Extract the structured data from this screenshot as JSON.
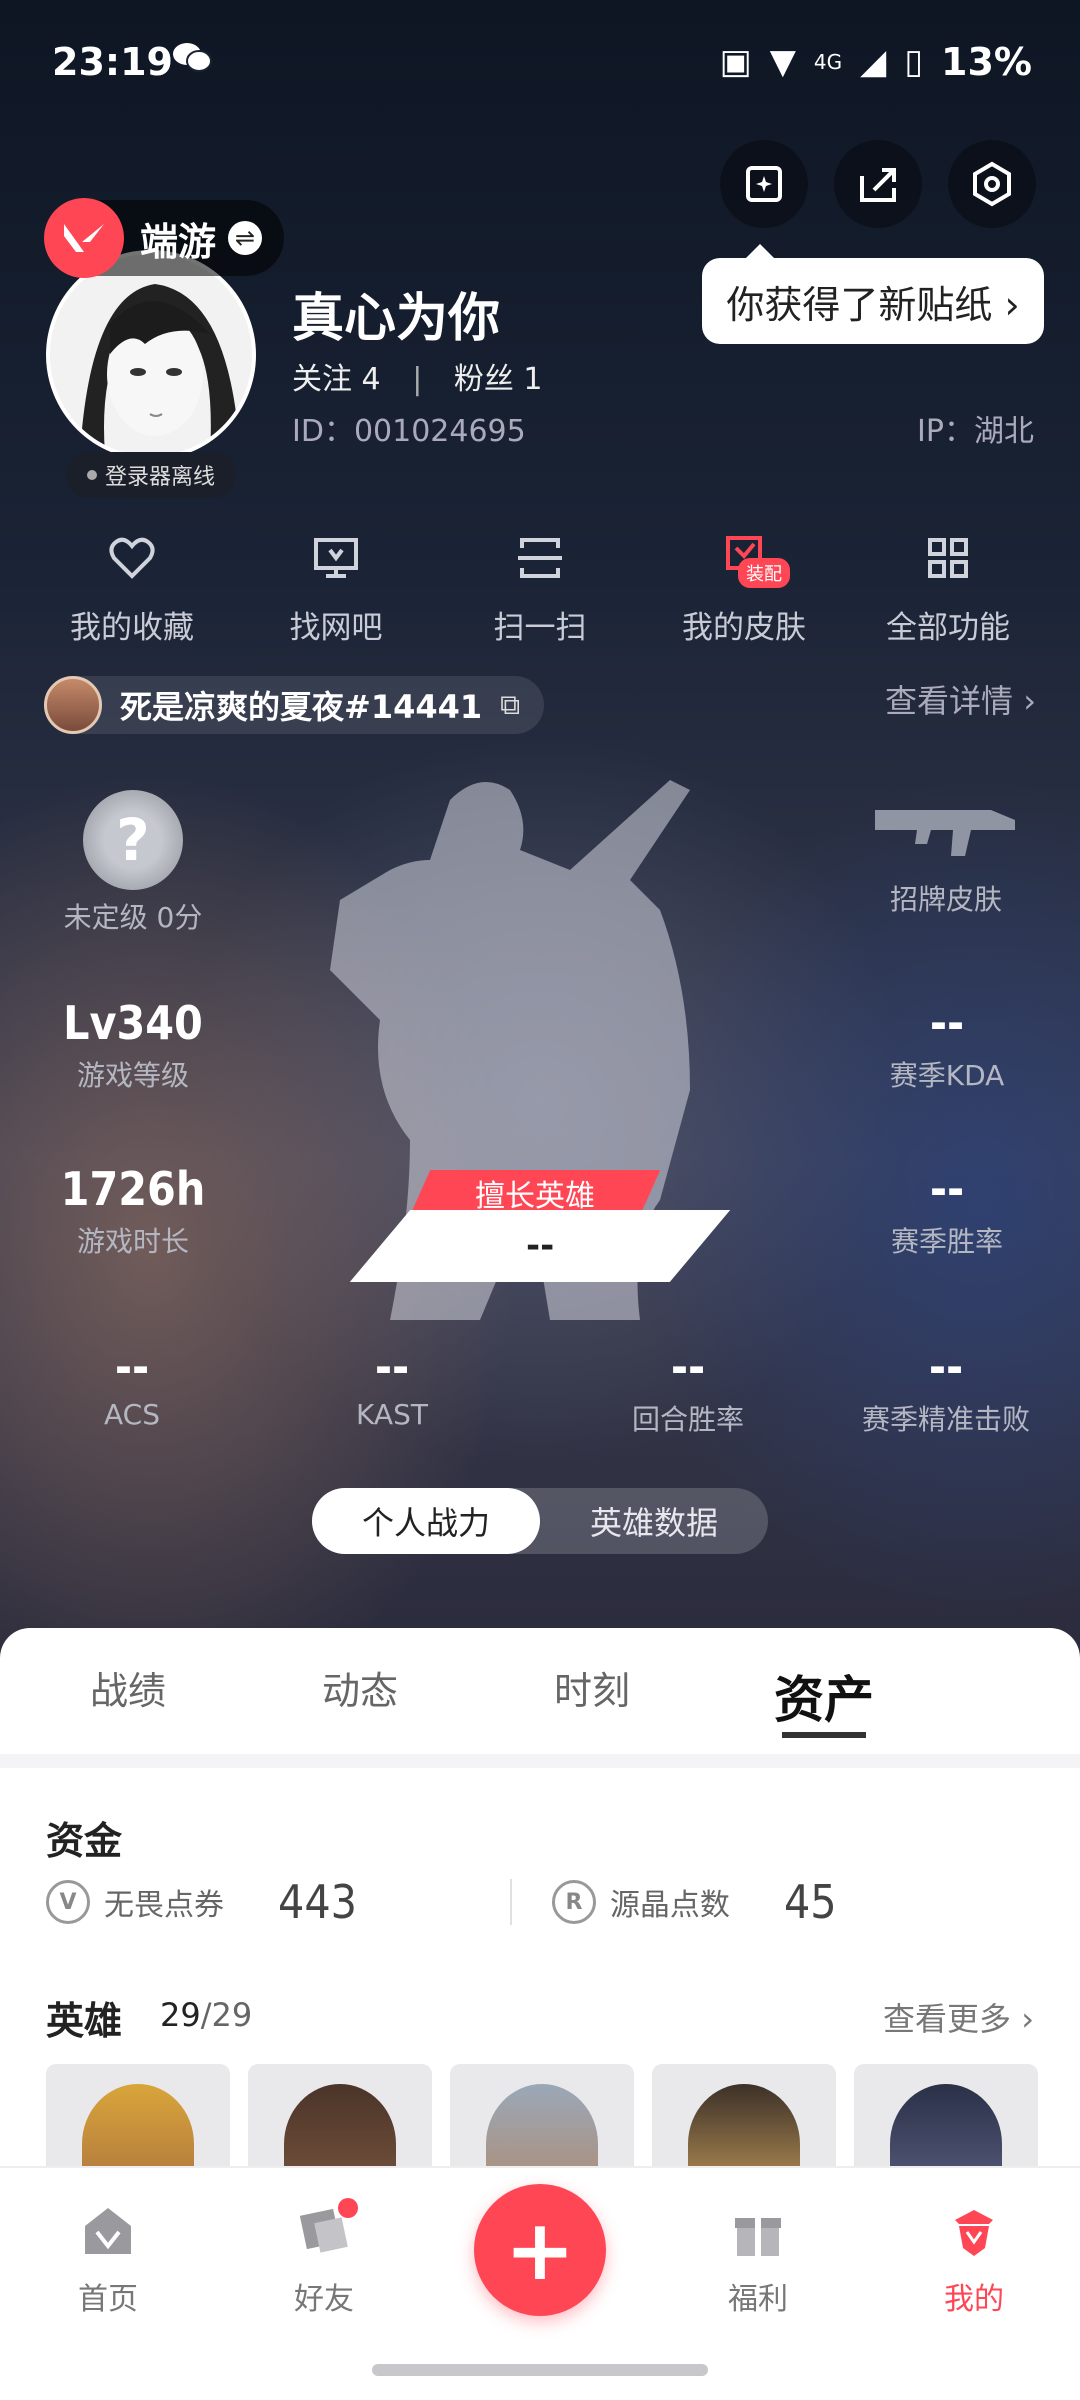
{
  "status_bar": {
    "time": "23:19",
    "network": "4G",
    "battery": "13%"
  },
  "profile": {
    "app_name": "端游",
    "nickname": "真心为你",
    "follow_label": "关注",
    "follow_count": "4",
    "fans_label": "粉丝",
    "fans_count": "1",
    "uid": "ID：001024695",
    "ip": "IP：湖北",
    "login_status": "登录器离线",
    "tooltip": "你获得了新贴纸 ›"
  },
  "functions": [
    {
      "label": "我的收藏",
      "icon": "heart-icon"
    },
    {
      "label": "找网吧",
      "icon": "monitor-icon"
    },
    {
      "label": "扫一扫",
      "icon": "scan-icon"
    },
    {
      "label": "我的皮肤",
      "icon": "skin-icon",
      "badge": "装配"
    },
    {
      "label": "全部功能",
      "icon": "grid-icon"
    }
  ],
  "riot_id": {
    "name": "死是凉爽的夏夜#14441",
    "detail_link": "查看详情 ›"
  },
  "stats": {
    "rank": {
      "value": "?",
      "label": "未定级 0分"
    },
    "skin": {
      "label": "招牌皮肤"
    },
    "level": {
      "value": "Lv340",
      "label": "游戏等级"
    },
    "kda": {
      "value": "--",
      "label": "赛季KDA"
    },
    "hours": {
      "value": "1726h",
      "label": "游戏时长"
    },
    "winrate": {
      "value": "--",
      "label": "赛季胜率"
    },
    "best_agent": {
      "tag": "擅长英雄",
      "value": "--"
    },
    "acs": {
      "value": "--",
      "label": "ACS"
    },
    "kast": {
      "value": "--",
      "label": "KAST"
    },
    "round_win": {
      "value": "--",
      "label": "回合胜率"
    },
    "precise": {
      "value": "--",
      "label": "赛季精准击败"
    }
  },
  "segment": {
    "left": "个人战力",
    "right": "英雄数据"
  },
  "tabs": [
    "战绩",
    "动态",
    "时刻",
    "资产"
  ],
  "assets": {
    "funds_title": "资金",
    "vp_label": "无畏点券",
    "vp_value": "443",
    "rp_label": "源晶点数",
    "rp_value": "45",
    "heroes_title": "英雄",
    "heroes_owned": "29",
    "heroes_total": "/29",
    "more": "查看更多 ›"
  },
  "bottom_nav": [
    {
      "label": "首页",
      "icon": "home-icon"
    },
    {
      "label": "好友",
      "icon": "friends-icon"
    },
    {
      "label": "福利",
      "icon": "gift-icon"
    },
    {
      "label": "我的",
      "icon": "profile-icon"
    }
  ],
  "colors": {
    "accent": "#ff4655"
  }
}
